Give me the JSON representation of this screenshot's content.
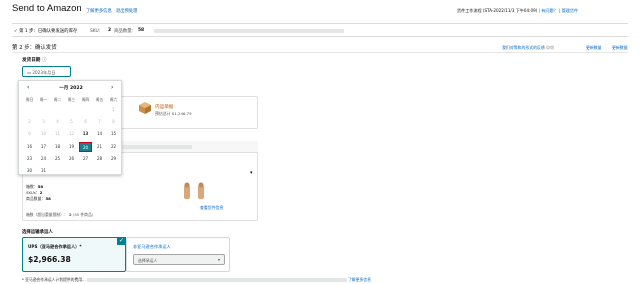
{
  "header": {
    "title": "Send to Amazon",
    "help_link": "了解更多信息",
    "exit_link": "退出预处理",
    "right_text": "货件工作流程 (STA-2022/11/3 下午04:09)",
    "right_link": "有问题？",
    "right_link2": "管理货件"
  },
  "step1": {
    "label": "✓ 第 1 步：已确认要发送的库存",
    "skus_label": "SKU：",
    "skus_value": "2",
    "units_label": "商品数量：",
    "units_value": "58"
  },
  "step2": {
    "title": "第 2 步：确认发货",
    "right_link": "我们对等和的形式的反馈",
    "right_link2": "更新数量",
    "right_link3": "更新数据"
  },
  "ship_date": {
    "label": "发货日期",
    "info_icon": "info-icon",
    "value": "2023年月日"
  },
  "calendar": {
    "month": "一月 2022",
    "prev_icon": "chevron-left-icon",
    "next_icon": "chevron-right-icon",
    "weekdays": [
      "周日",
      "周一",
      "周二",
      "周三",
      "周四",
      "周五",
      "周六"
    ],
    "weeks": [
      [
        "",
        "",
        "",
        "",
        "",
        "",
        "1"
      ],
      [
        "2",
        "3",
        "4",
        "5",
        "6",
        "7",
        "8"
      ],
      [
        "9",
        "10",
        "11",
        "12",
        "13",
        "14",
        "15"
      ],
      [
        "16",
        "17",
        "18",
        "19",
        "20",
        "21",
        "22"
      ],
      [
        "23",
        "24",
        "25",
        "26",
        "27",
        "28",
        "29"
      ],
      [
        "30",
        "31",
        "",
        "",
        "",
        "",
        ""
      ]
    ],
    "selected_day": "20"
  },
  "box": {
    "icon": "package-icon",
    "label": "内运单据",
    "weight": "预估总计 $1,246.79"
  },
  "shipment": {
    "title": "运件内容",
    "boxes_label": "箱数：",
    "boxes_value": "58",
    "skus_label": "SKUs：",
    "skus_value": "2",
    "units_label": "商品数量：",
    "units_value": "58",
    "view_contents": "查看货件信息",
    "box_count_text": "箱数（超出重量限制）：",
    "box_count_value": "2",
    "box_count_suffix": "(55 件商品)"
  },
  "carrier": {
    "label": "选择运输承运人",
    "ups_name": "UPS（亚马逊合作承运人）*",
    "ups_price": "$2,966.38",
    "check_icon": "check-icon",
    "non_partnered": "非亚马逊合作承运人",
    "select_placeholder": "选择承运人",
    "select_arrow": "chevron-down-icon"
  },
  "footer": {
    "note": "* 亚马逊合作承运人计划提供的费用...",
    "link": "了解更多信息"
  },
  "colors": {
    "accent_teal": "#008296",
    "link_blue": "#0066c0",
    "selected_outline": "#d0021b",
    "orange": "#c45500"
  }
}
